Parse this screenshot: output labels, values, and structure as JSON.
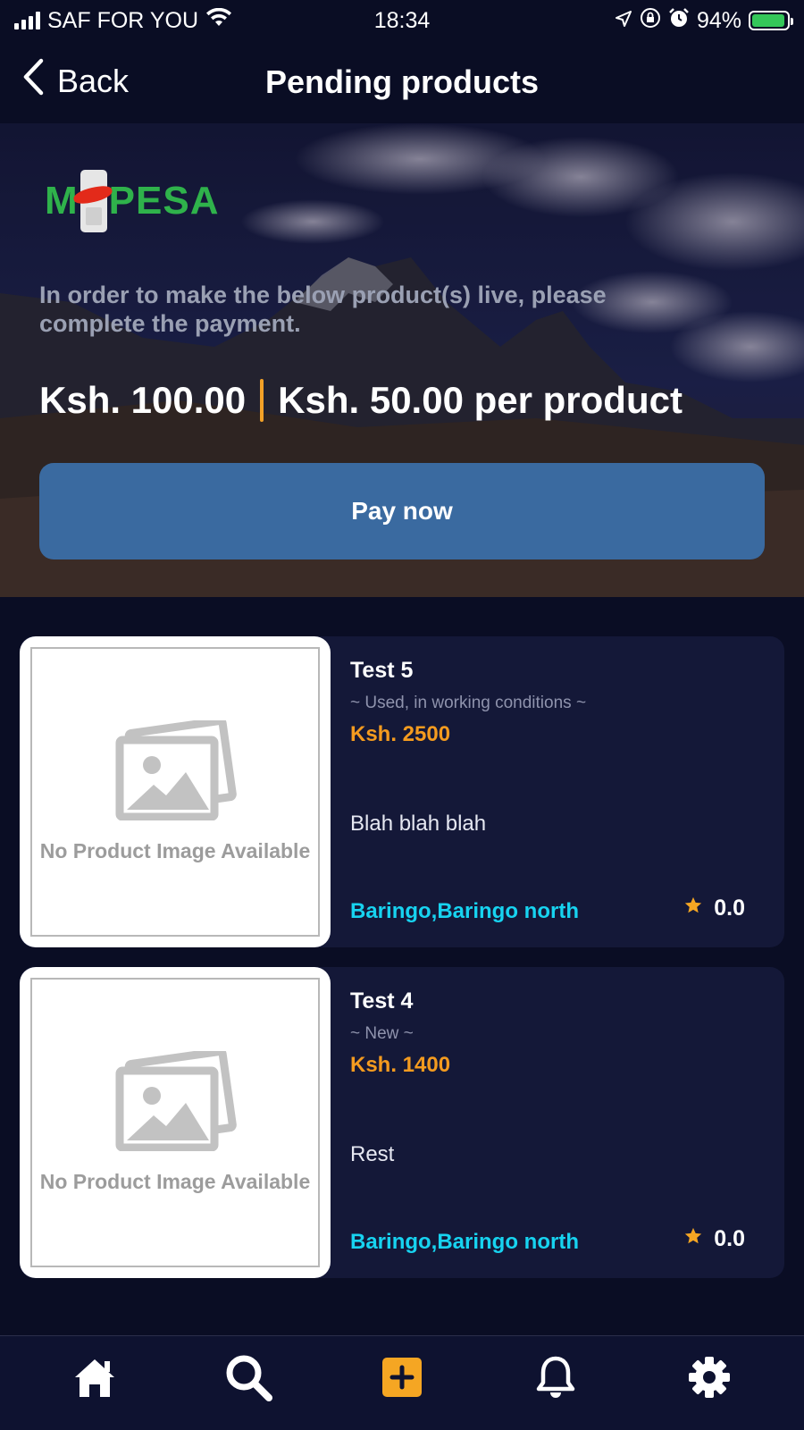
{
  "status_bar": {
    "carrier": "SAF FOR YOU",
    "time": "18:34",
    "battery_percent": "94%",
    "battery_level": 0.94,
    "icons": [
      "signal-icon",
      "wifi-icon",
      "location-icon",
      "orientation-lock-icon",
      "alarm-icon",
      "battery-charging-icon"
    ]
  },
  "nav": {
    "back_label": "Back",
    "title": "Pending products"
  },
  "banner": {
    "logo_text_left": "M",
    "logo_text_right": "PESA",
    "message": "In order to make the below product(s) live, please complete the payment.",
    "total_price": "Ksh. 100.00",
    "unit_price": "Ksh. 50.00 per product",
    "pay_button_label": "Pay now",
    "colors": {
      "pay_button": "#3a6aa0",
      "divider": "#f2a127",
      "logo_green": "#2fb24b",
      "logo_red": "#e32a1a"
    }
  },
  "products": [
    {
      "image_placeholder_text": "No Product Image Available",
      "title": "Test 5",
      "condition": "~ Used, in working conditions ~",
      "price": "Ksh. 2500",
      "description": "Blah blah blah",
      "location": "Baringo,Baringo north",
      "rating": "0.0"
    },
    {
      "image_placeholder_text": "No Product Image Available",
      "title": "Test 4",
      "condition": "~ New ~",
      "price": "Ksh. 1400",
      "description": "Rest",
      "location": "Baringo,Baringo north",
      "rating": "0.0"
    }
  ],
  "tab_bar": {
    "items": [
      {
        "icon": "home-icon"
      },
      {
        "icon": "search-icon"
      },
      {
        "icon": "add-icon",
        "active_color": "#f5a623"
      },
      {
        "icon": "bell-icon"
      },
      {
        "icon": "gear-icon"
      }
    ]
  },
  "colors": {
    "background": "#0a0d24",
    "card": "#141838",
    "price": "#f49b1f",
    "location": "#17d3f0",
    "star": "#f5a623"
  }
}
